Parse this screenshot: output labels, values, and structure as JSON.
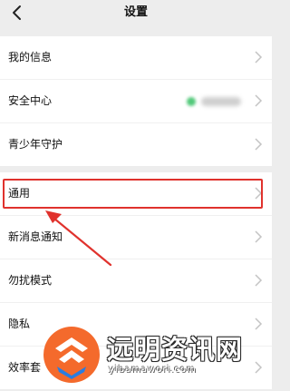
{
  "header": {
    "title": "设置",
    "back_icon": "chevron-left-icon"
  },
  "groups": [
    {
      "items": [
        {
          "label": "我的信息"
        },
        {
          "label": "安全中心"
        },
        {
          "label": "青少年守护"
        }
      ]
    },
    {
      "items": [
        {
          "label": "通用"
        },
        {
          "label": "新消息通知"
        },
        {
          "label": "勿扰模式"
        },
        {
          "label": "隐私"
        },
        {
          "label": "效率套"
        }
      ]
    }
  ],
  "annotation": {
    "highlight_color": "#e0322d",
    "highlighted_item": "通用"
  },
  "watermark": {
    "text": "远明资讯网",
    "subtext": "yibamawori.com"
  },
  "colors": {
    "background": "#ededed",
    "card": "#ffffff",
    "status_green": "#52c97a"
  }
}
